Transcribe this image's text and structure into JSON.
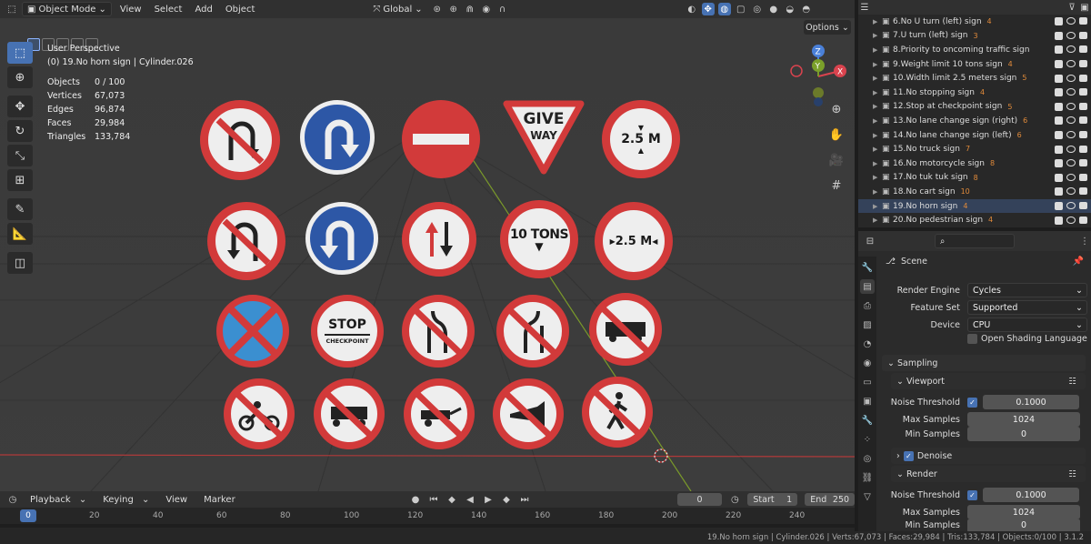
{
  "header": {
    "mode": "Object Mode",
    "menus": [
      "View",
      "Select",
      "Add",
      "Object"
    ],
    "orientation": "Global"
  },
  "viewport": {
    "title": "User Perspective",
    "active": "(0) 19.No horn sign | Cylinder.026",
    "stats": [
      {
        "label": "Objects",
        "value": "0 / 100"
      },
      {
        "label": "Vertices",
        "value": "67,073"
      },
      {
        "label": "Edges",
        "value": "96,874"
      },
      {
        "label": "Faces",
        "value": "29,984"
      },
      {
        "label": "Triangles",
        "value": "133,784"
      }
    ],
    "options_label": "Options",
    "gizmo": {
      "z": "Z",
      "x": "X",
      "y": "Y"
    }
  },
  "signs": {
    "give": "GIVE",
    "way": "WAY",
    "m1": "2.5 M",
    "tons": "10 TONS",
    "m2": "2.5 M",
    "stop": "STOP",
    "checkpoint": "CHECKPOINT"
  },
  "outliner": {
    "items": [
      {
        "name": "6.No U turn (left) sign",
        "badge": "4"
      },
      {
        "name": "7.U turn (left) sign",
        "badge": "3"
      },
      {
        "name": "8.Priority to oncoming traffic sign",
        "badge": ""
      },
      {
        "name": "9.Weight limit 10 tons sign",
        "badge": "4"
      },
      {
        "name": "10.Width limit 2.5 meters sign",
        "badge": "5"
      },
      {
        "name": "11.No stopping sign",
        "badge": "4"
      },
      {
        "name": "12.Stop at checkpoint sign",
        "badge": "5"
      },
      {
        "name": "13.No lane change sign (right)",
        "badge": "6"
      },
      {
        "name": "14.No lane change sign (left)",
        "badge": "6"
      },
      {
        "name": "15.No truck sign",
        "badge": "7"
      },
      {
        "name": "16.No motorcycle sign",
        "badge": "8"
      },
      {
        "name": "17.No tuk tuk sign",
        "badge": "8"
      },
      {
        "name": "18.No cart sign",
        "badge": "10"
      },
      {
        "name": "19.No horn sign",
        "badge": "4"
      },
      {
        "name": "20.No pedestrian sign",
        "badge": "4"
      }
    ]
  },
  "properties": {
    "scene": "Scene",
    "render_engine_label": "Render Engine",
    "render_engine": "Cycles",
    "feature_set_label": "Feature Set",
    "feature_set": "Supported",
    "device_label": "Device",
    "device": "CPU",
    "osl": "Open Shading Language",
    "sampling": "Sampling",
    "viewport": "Viewport",
    "noise_threshold_label": "Noise Threshold",
    "noise_threshold_viewport": "0.1000",
    "max_samples_label": "Max Samples",
    "max_samples_viewport": "1024",
    "min_samples_label": "Min Samples",
    "min_samples_viewport": "0",
    "denoise": "Denoise",
    "render": "Render",
    "noise_threshold_render": "0.1000",
    "max_samples_render": "1024",
    "min_samples_render": "0"
  },
  "timeline": {
    "menus": [
      "Playback",
      "Keying",
      "View",
      "Marker"
    ],
    "frame": "0",
    "start_label": "Start",
    "start": "1",
    "end_label": "End",
    "end": "250",
    "ticks": [
      "0",
      "20",
      "40",
      "60",
      "80",
      "100",
      "120",
      "140",
      "160",
      "180",
      "200",
      "220",
      "240"
    ]
  },
  "status": {
    "text": "19.No horn sign | Cylinder.026 | Verts:67,073 | Faces:29,984 | Tris:133,784 | Objects:0/100 | 3.1.2"
  }
}
